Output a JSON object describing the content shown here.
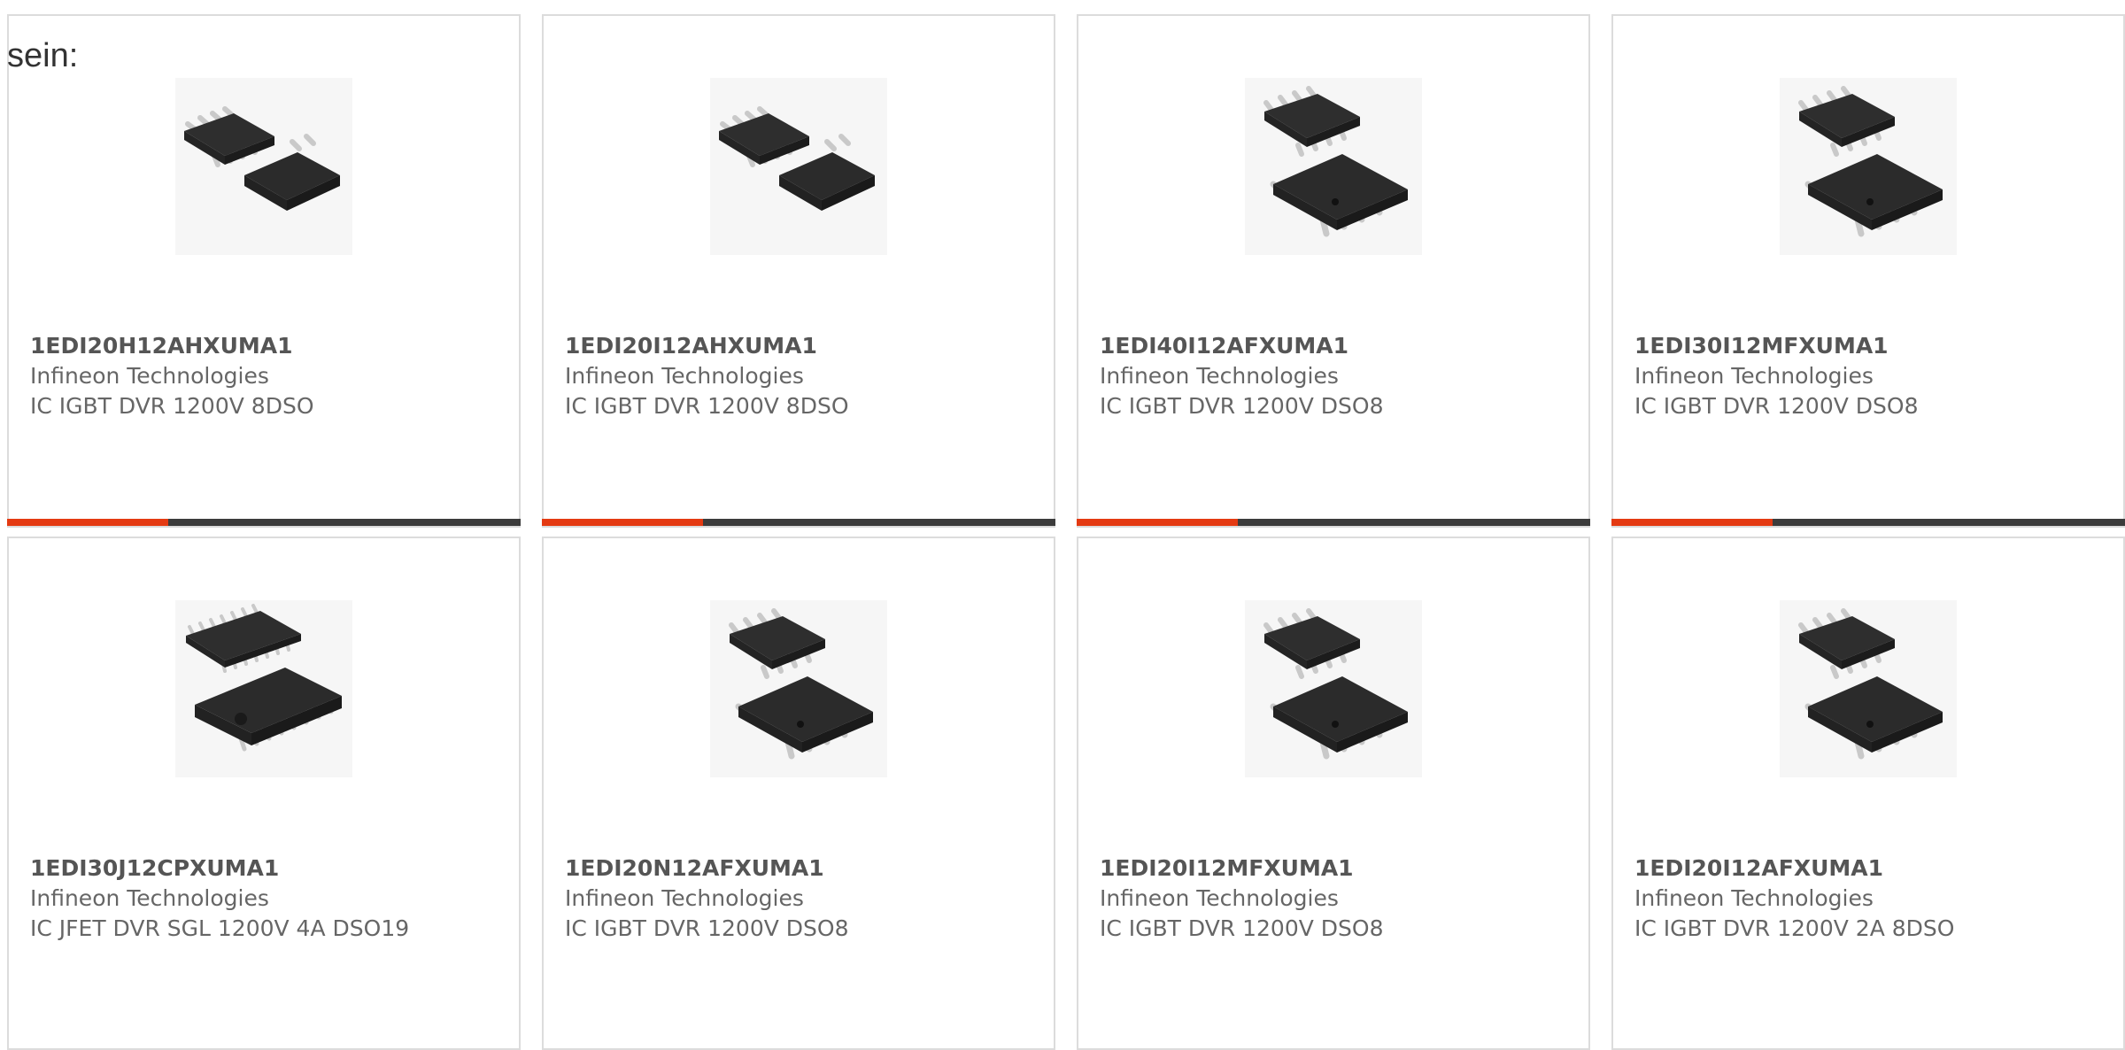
{
  "intro_text": "sein:",
  "accent_color": "#e43a12",
  "bar_color": "#3c3c3c",
  "products": [
    {
      "part": "1EDI20H12AHXUMA1",
      "manufacturer": "Infineon Technologies",
      "description": "IC IGBT DVR 1200V 8DSO",
      "image_icon": "soic-8-pair-icon"
    },
    {
      "part": "1EDI20I12AHXUMA1",
      "manufacturer": "Infineon Technologies",
      "description": "IC IGBT DVR 1200V 8DSO",
      "image_icon": "soic-8-pair-icon"
    },
    {
      "part": "1EDI40I12AFXUMA1",
      "manufacturer": "Infineon Technologies",
      "description": "IC IGBT DVR 1200V DSO8",
      "image_icon": "soic-8-stacked-icon"
    },
    {
      "part": "1EDI30I12MFXUMA1",
      "manufacturer": "Infineon Technologies",
      "description": "IC IGBT DVR 1200V DSO8",
      "image_icon": "soic-8-stacked-icon"
    },
    {
      "part": "1EDI30J12CPXUMA1",
      "manufacturer": "Infineon Technologies",
      "description": "IC JFET DVR SGL 1200V 4A DSO19",
      "image_icon": "dso-19-stacked-icon"
    },
    {
      "part": "1EDI20N12AFXUMA1",
      "manufacturer": "Infineon Technologies",
      "description": "IC IGBT DVR 1200V DSO8",
      "image_icon": "soic-8-stacked-icon"
    },
    {
      "part": "1EDI20I12MFXUMA1",
      "manufacturer": "Infineon Technologies",
      "description": "IC IGBT DVR 1200V DSO8",
      "image_icon": "soic-8-stacked-icon"
    },
    {
      "part": "1EDI20I12AFXUMA1",
      "manufacturer": "Infineon Technologies",
      "description": "IC IGBT DVR 1200V 2A 8DSO",
      "image_icon": "soic-8-stacked-icon"
    }
  ]
}
